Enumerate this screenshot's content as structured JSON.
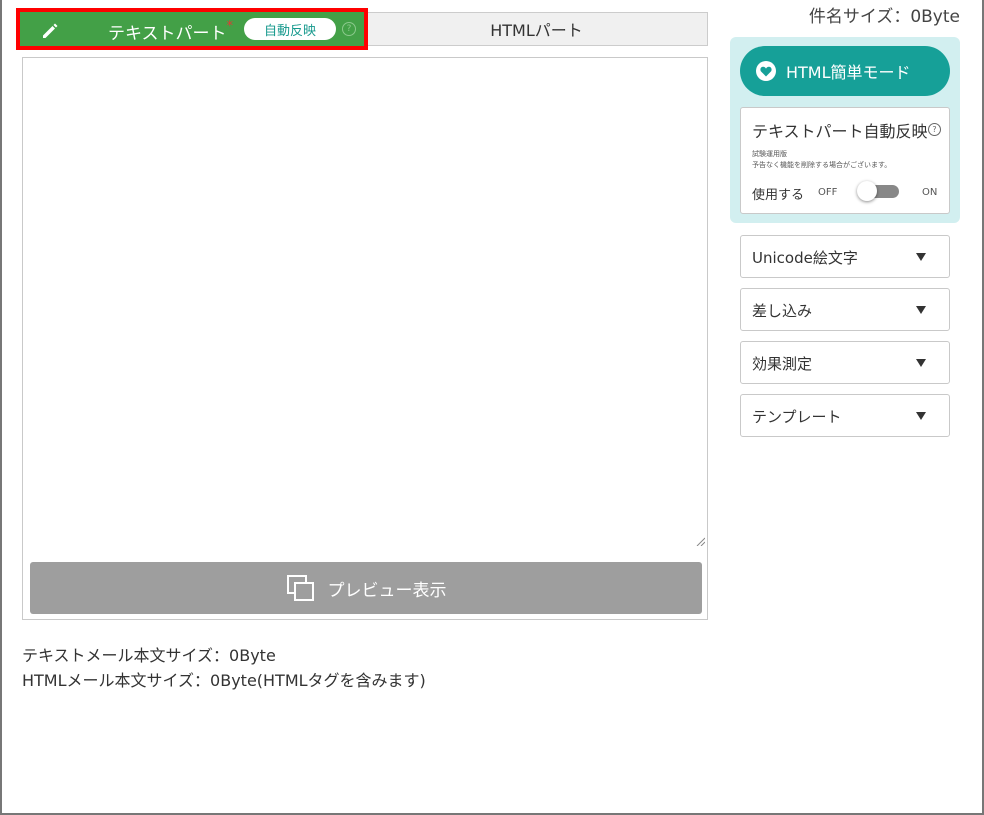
{
  "tabs": {
    "text_tab_label": "テキストパート",
    "required_mark": "*",
    "auto_reflect_badge": "自動反映",
    "help_glyph": "?",
    "html_tab_label": "HTMLパート"
  },
  "subject_size": "件名サイズ：0Byte",
  "editor": {
    "preview_label": "プレビュー表示"
  },
  "sizes": {
    "text_mail_size": "テキストメール本文サイズ：0Byte",
    "html_mail_size": "HTMLメール本文サイズ：0Byte(HTMLタグを含みます)"
  },
  "panel": {
    "html_mode_label": "HTML簡単モード",
    "auto_card": {
      "title": "テキストパート自動反映",
      "note_trial": "試験運用版",
      "note_warning": "予告なく機能を削除する場合がございます。",
      "use_label": "使用する",
      "off_label": "OFF",
      "on_label": "ON",
      "toggle_on": false
    },
    "dropdowns": [
      "Unicode絵文字",
      "差し込み",
      "効果測定",
      "テンプレート"
    ]
  },
  "colors": {
    "text_tab": "#43a047",
    "teal": "#16a098",
    "highlight": "#ff0000"
  }
}
